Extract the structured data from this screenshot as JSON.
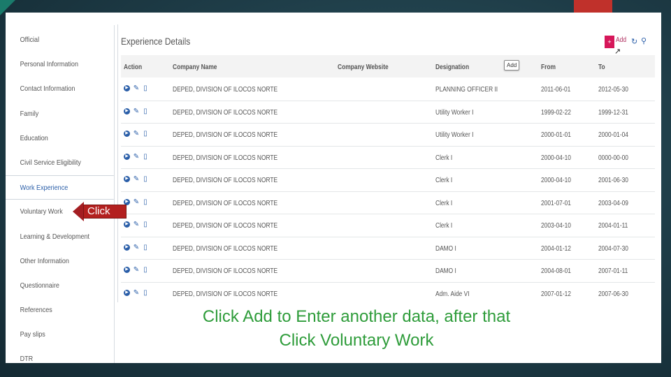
{
  "sidebar": {
    "items": [
      {
        "label": "Official",
        "active": false
      },
      {
        "label": "Personal Information",
        "active": false
      },
      {
        "label": "Contact Information",
        "active": false
      },
      {
        "label": "Family",
        "active": false
      },
      {
        "label": "Education",
        "active": false
      },
      {
        "label": "Civil Service Eligibility",
        "active": false
      },
      {
        "label": "Work Experience",
        "active": true
      },
      {
        "label": "Voluntary Work",
        "active": false
      },
      {
        "label": "Learning & Development",
        "active": false
      },
      {
        "label": "Other Information",
        "active": false
      },
      {
        "label": "Questionnaire",
        "active": false
      },
      {
        "label": "References",
        "active": false
      },
      {
        "label": "Pay slips",
        "active": false
      },
      {
        "label": "DTR",
        "active": false
      }
    ]
  },
  "section": {
    "title": "Experience Details"
  },
  "toolbar": {
    "add_label": "Add",
    "tooltip": "Add",
    "add_icon": "plus-icon",
    "refresh_icon": "refresh-icon",
    "search_icon": "search-icon"
  },
  "table": {
    "headers": [
      "Action",
      "Company Name",
      "Company Website",
      "Designation",
      "From",
      "To"
    ],
    "rows": [
      {
        "company": "DEPED, DIVISION OF ILOCOS NORTE",
        "website": "",
        "designation": "PLANNING OFFICER II",
        "from": "2011-06-01",
        "to": "2012-05-30"
      },
      {
        "company": "DEPED, DIVISION OF ILOCOS NORTE",
        "website": "",
        "designation": "Utility Worker I",
        "from": "1999-02-22",
        "to": "1999-12-31"
      },
      {
        "company": "DEPED, DIVISION OF ILOCOS NORTE",
        "website": "",
        "designation": "Utility Worker I",
        "from": "2000-01-01",
        "to": "2000-01-04"
      },
      {
        "company": "DEPED, DIVISION OF ILOCOS NORTE",
        "website": "",
        "designation": "Clerk I",
        "from": "2000-04-10",
        "to": "0000-00-00"
      },
      {
        "company": "DEPED, DIVISION OF ILOCOS NORTE",
        "website": "",
        "designation": "Clerk I",
        "from": "2000-04-10",
        "to": "2001-06-30"
      },
      {
        "company": "DEPED, DIVISION OF ILOCOS NORTE",
        "website": "",
        "designation": "Clerk I",
        "from": "2001-07-01",
        "to": "2003-04-09"
      },
      {
        "company": "DEPED, DIVISION OF ILOCOS NORTE",
        "website": "",
        "designation": "Clerk I",
        "from": "2003-04-10",
        "to": "2004-01-11"
      },
      {
        "company": "DEPED, DIVISION OF ILOCOS NORTE",
        "website": "",
        "designation": "DAMO I",
        "from": "2004-01-12",
        "to": "2004-07-30"
      },
      {
        "company": "DEPED, DIVISION OF ILOCOS NORTE",
        "website": "",
        "designation": "DAMO I",
        "from": "2004-08-01",
        "to": "2007-01-11"
      },
      {
        "company": "DEPED, DIVISION OF ILOCOS NORTE",
        "website": "",
        "designation": "Adm. Aide VI",
        "from": "2007-01-12",
        "to": "2007-06-30"
      }
    ],
    "action_icons": [
      "view-icon",
      "edit-icon",
      "delete-icon"
    ]
  },
  "annotation": {
    "instruction_line1": "Click Add to Enter another data, after that",
    "instruction_line2": "Click Voluntary Work",
    "callout_label": "Click"
  },
  "colors": {
    "accent": "#d6175a",
    "link": "#2a5ea8",
    "instruction": "#2e9c3a",
    "callout": "#b3201f",
    "slide_accent": "#c0312b"
  }
}
